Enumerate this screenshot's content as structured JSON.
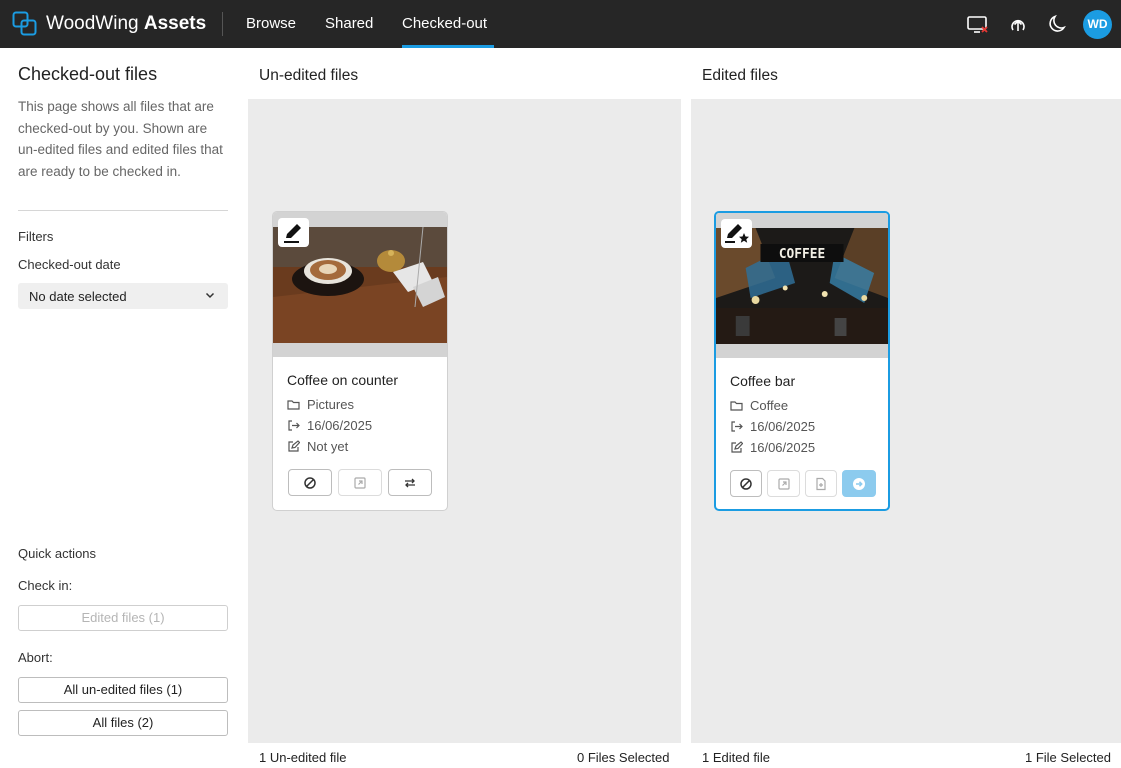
{
  "header": {
    "logo_text_light": "WoodWing",
    "logo_text_bold": "Assets",
    "tabs": [
      {
        "label": "Browse",
        "active": false
      },
      {
        "label": "Shared",
        "active": false
      },
      {
        "label": "Checked-out",
        "active": true
      }
    ],
    "icons": [
      "screen-disconnect-icon",
      "upload-cloud-icon",
      "dark-mode-moon-icon"
    ],
    "avatar_initials": "WD",
    "accent_color": "#1b9ce2"
  },
  "sidebar": {
    "title": "Checked-out files",
    "description": "This page shows all files that are checked-out by you. Shown are un-edited files and edited files that are ready to be checked in.",
    "filters_label": "Filters",
    "checked_out_date_label": "Checked-out date",
    "date_select_value": "No date selected",
    "quick_actions_label": "Quick actions",
    "check_in_label": "Check in:",
    "check_in_button": "Edited files (1)",
    "abort_label": "Abort:",
    "abort_unedited_button": "All un-edited files (1)",
    "abort_all_button": "All files (2)"
  },
  "unedited": {
    "title": "Un-edited files",
    "footer_count": "1 Un-edited file",
    "footer_selected": "0 Files Selected",
    "cards": [
      {
        "name": "Coffee on counter",
        "folder": "Pictures",
        "checked_out": "16/06/2025",
        "edited": "Not yet"
      }
    ]
  },
  "edited": {
    "title": "Edited files",
    "footer_count": "1 Edited file",
    "footer_selected": "1 File Selected",
    "cards": [
      {
        "name": "Coffee bar",
        "folder": "Coffee",
        "checked_out": "16/06/2025",
        "edited": "16/06/2025",
        "sign_text": "COFFEE",
        "selected": true
      }
    ]
  }
}
